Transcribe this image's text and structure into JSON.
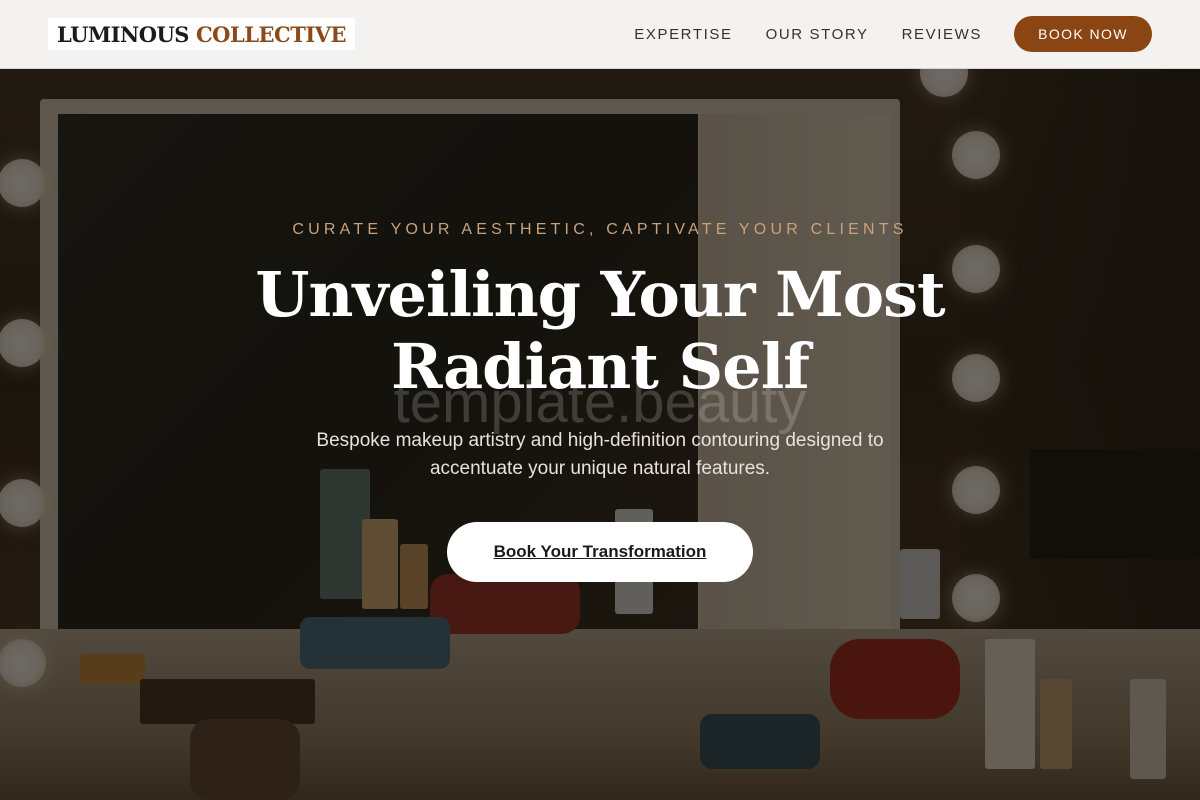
{
  "brand": {
    "name_part1": "LUMINOUS",
    "name_part2": "COLLECTIVE",
    "accent_color": "#8b4513"
  },
  "nav": {
    "items": [
      {
        "label": "EXPERTISE"
      },
      {
        "label": "OUR STORY"
      },
      {
        "label": "REVIEWS"
      }
    ],
    "cta_label": "BOOK NOW"
  },
  "hero": {
    "eyebrow": "CURATE YOUR AESTHETIC, CAPTIVATE YOUR CLIENTS",
    "headline_line1": "Unveiling Your Most",
    "headline_line2": "Radiant Self",
    "watermark": "template.beauty",
    "subtext": "Bespoke makeup artistry and high-definition contouring designed to accentuate your unique natural features.",
    "cta_label": "Book Your Transformation",
    "background_image": "makeup-vanity-mirror-with-bulbs"
  }
}
